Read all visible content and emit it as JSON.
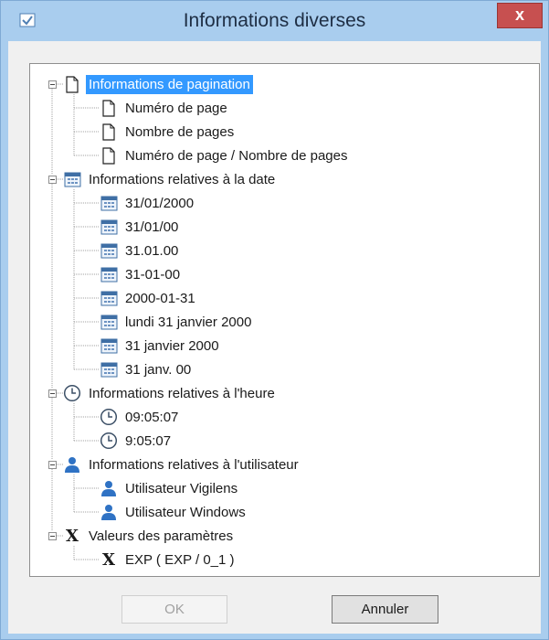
{
  "window": {
    "title": "Informations diverses",
    "close_label": "x"
  },
  "tree": {
    "groups": [
      {
        "label": "Informations de pagination",
        "icon": "page-icon",
        "selected": true,
        "children": [
          {
            "label": "Numéro de page",
            "icon": "page-icon"
          },
          {
            "label": "Nombre de pages",
            "icon": "page-icon"
          },
          {
            "label": "Numéro de page / Nombre de pages",
            "icon": "page-icon"
          }
        ]
      },
      {
        "label": "Informations relatives à la date",
        "icon": "calendar-icon",
        "children": [
          {
            "label": "31/01/2000",
            "icon": "calendar-icon"
          },
          {
            "label": "31/01/00",
            "icon": "calendar-icon"
          },
          {
            "label": "31.01.00",
            "icon": "calendar-icon"
          },
          {
            "label": "31-01-00",
            "icon": "calendar-icon"
          },
          {
            "label": "2000-01-31",
            "icon": "calendar-icon"
          },
          {
            "label": "lundi 31 janvier 2000",
            "icon": "calendar-icon"
          },
          {
            "label": "31 janvier 2000",
            "icon": "calendar-icon"
          },
          {
            "label": "31 janv. 00",
            "icon": "calendar-icon"
          }
        ]
      },
      {
        "label": "Informations relatives à l'heure",
        "icon": "clock-icon",
        "children": [
          {
            "label": "09:05:07",
            "icon": "clock-icon"
          },
          {
            "label": "9:05:07",
            "icon": "clock-icon"
          }
        ]
      },
      {
        "label": "Informations relatives à l'utilisateur",
        "icon": "user-icon",
        "children": [
          {
            "label": "Utilisateur Vigilens",
            "icon": "user-icon"
          },
          {
            "label": "Utilisateur Windows",
            "icon": "user-icon"
          }
        ]
      },
      {
        "label": "Valeurs des paramètres",
        "icon": "variable-x-icon",
        "children": [
          {
            "label": "EXP ( EXP / 0_1 )",
            "icon": "variable-x-icon"
          }
        ]
      }
    ]
  },
  "buttons": {
    "ok_label": "OK",
    "cancel_label": "Annuler"
  },
  "colors": {
    "selection": "#3399ff",
    "titlebar": "#a9cdee",
    "close": "#c75050"
  }
}
